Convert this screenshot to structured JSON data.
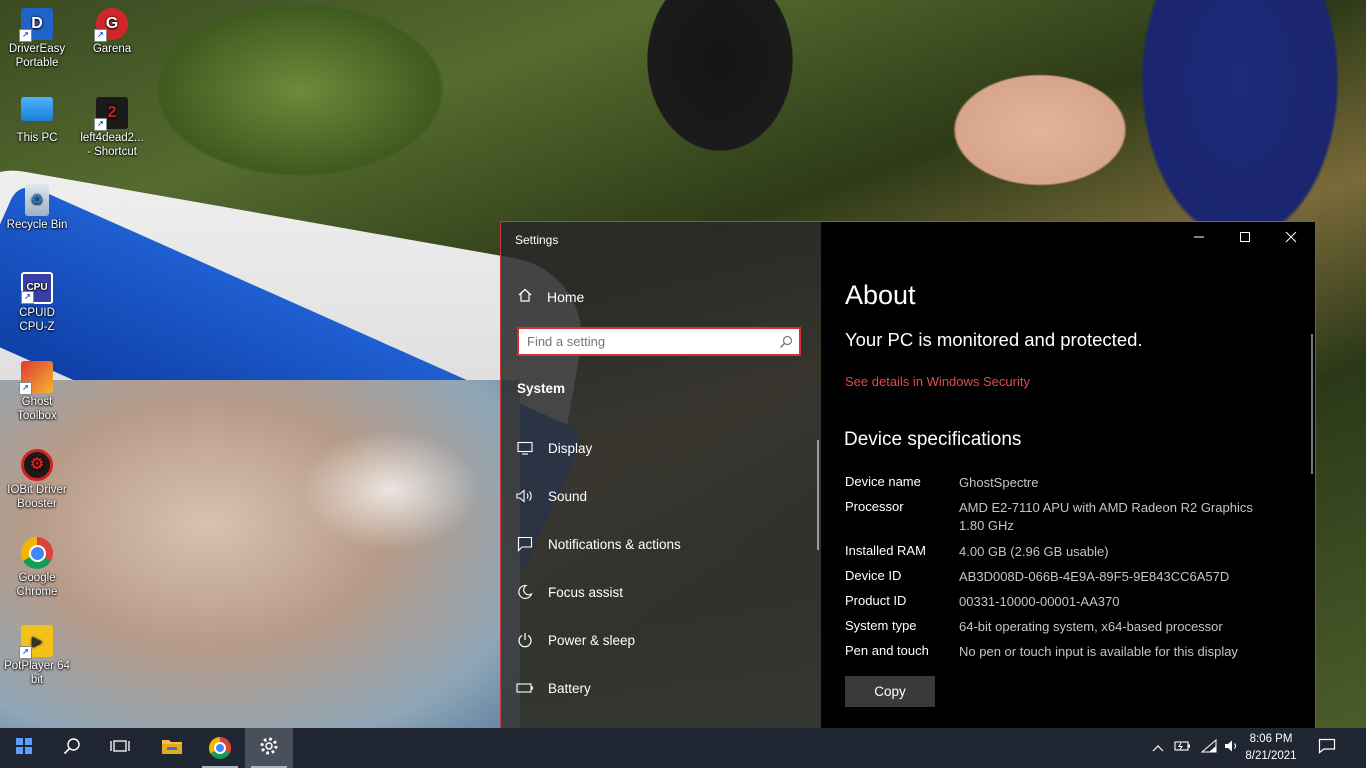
{
  "desktop": {
    "icons": [
      {
        "label": "DriverEasy Portable",
        "line1": "DriverEasy",
        "line2": "Portable"
      },
      {
        "label": "Garena",
        "line1": "Garena",
        "line2": ""
      },
      {
        "label": "This PC",
        "line1": "This PC",
        "line2": ""
      },
      {
        "label": "left4dead2... - Shortcut",
        "line1": "left4dead2...",
        "line2": "- Shortcut"
      },
      {
        "label": "Recycle Bin",
        "line1": "Recycle Bin",
        "line2": ""
      },
      {
        "label": "CPUID CPU-Z",
        "line1": "CPUID",
        "line2": "CPU-Z"
      },
      {
        "label": "Ghost Toolbox",
        "line1": "Ghost",
        "line2": "Toolbox"
      },
      {
        "label": "IOBit Driver Booster",
        "line1": "IOBit Driver",
        "line2": "Booster"
      },
      {
        "label": "Google Chrome",
        "line1": "Google",
        "line2": "Chrome"
      },
      {
        "label": "PotPlayer 64 bit",
        "line1": "PotPlayer 64",
        "line2": "bit"
      }
    ]
  },
  "window": {
    "app_title": "Settings",
    "accent_color": "#c63c3c",
    "controls": [
      "minimize-icon",
      "maximize-icon",
      "close-icon"
    ]
  },
  "nav": {
    "home_label": "Home",
    "search_placeholder": "Find a setting",
    "section_label": "System",
    "items": [
      {
        "label": "Display",
        "icon": "display-icon"
      },
      {
        "label": "Sound",
        "icon": "sound-icon"
      },
      {
        "label": "Notifications & actions",
        "icon": "notifications-icon"
      },
      {
        "label": "Focus assist",
        "icon": "focus-assist-icon"
      },
      {
        "label": "Power & sleep",
        "icon": "power-icon"
      },
      {
        "label": "Battery",
        "icon": "battery-icon"
      }
    ]
  },
  "about": {
    "title": "About",
    "protection_status": "Your PC is monitored and protected.",
    "security_link": "See details in Windows Security",
    "link_color": "#e24b4b",
    "specs_heading": "Device specifications",
    "specs": [
      {
        "key": "Device name",
        "value": "GhostSpectre"
      },
      {
        "key": "Processor",
        "value": "AMD E2-7110 APU with AMD Radeon R2 Graphics 1.80 GHz"
      },
      {
        "key": "Installed RAM",
        "value": "4.00 GB (2.96 GB usable)"
      },
      {
        "key": "Device ID",
        "value": "AB3D008D-066B-4E9A-89F5-9E843CC6A57D"
      },
      {
        "key": "Product ID",
        "value": "00331-10000-00001-AA370"
      },
      {
        "key": "System type",
        "value": "64-bit operating system, x64-based processor"
      },
      {
        "key": "Pen and touch",
        "value": "No pen or touch input is available for this display"
      }
    ],
    "copy_label": "Copy"
  },
  "taskbar": {
    "items": [
      "start-icon",
      "search-icon",
      "task-view-icon",
      "file-explorer-icon",
      "chrome-icon",
      "settings-icon"
    ],
    "time": "8:06 PM",
    "date": "8/21/2021"
  }
}
